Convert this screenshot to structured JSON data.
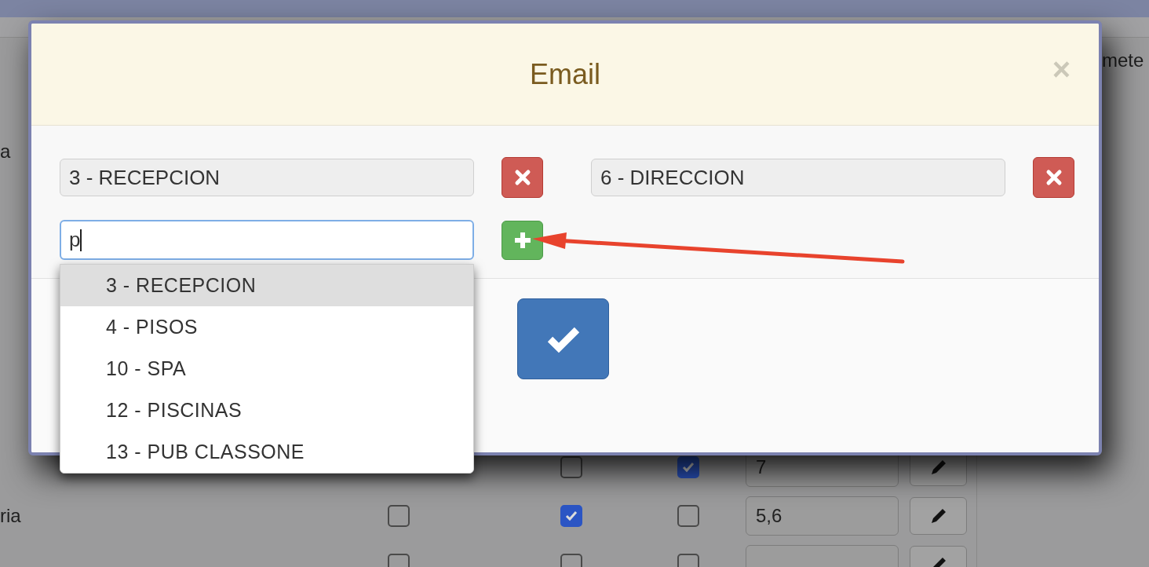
{
  "background": {
    "column_heading": "mete",
    "labels": [
      {
        "text": "a"
      },
      {
        "text": "ria"
      }
    ],
    "rows": [
      {
        "checks": [
          {
            "checked": false
          },
          {
            "checked": true
          }
        ],
        "value": "7"
      },
      {
        "checks": [
          {
            "checked": false
          },
          {
            "checked": true
          },
          {
            "checked": false
          }
        ],
        "value": "5,6"
      },
      {
        "checks": [
          {
            "checked": false
          },
          {
            "checked": false
          },
          {
            "checked": false
          }
        ]
      }
    ]
  },
  "dialog": {
    "title": "Email",
    "close": "×",
    "recipients": [
      {
        "value": "3 - RECEPCION"
      },
      {
        "value": "6 - DIRECCION"
      }
    ],
    "new_recipient": {
      "value": "p"
    },
    "suggestions": [
      {
        "label": "3 - RECEPCION",
        "selected": true
      },
      {
        "label": "4 - PISOS",
        "selected": false
      },
      {
        "label": "10 - SPA",
        "selected": false
      },
      {
        "label": "12 - PISCINAS",
        "selected": false
      },
      {
        "label": "13 - PUB CLASSONE",
        "selected": false
      }
    ]
  }
}
